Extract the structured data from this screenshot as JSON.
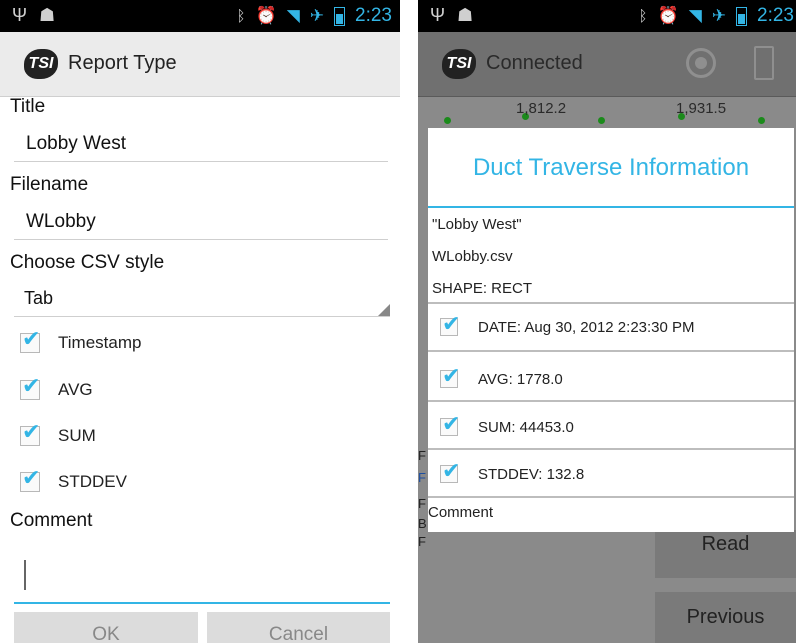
{
  "left": {
    "status": {
      "time": "2:23"
    },
    "actionbar": {
      "logo": "TSI",
      "title": "Report Type"
    },
    "form": {
      "title_label": "Title",
      "title_value": "Lobby West",
      "filename_label": "Filename",
      "filename_value": "WLobby",
      "csv_label": "Choose CSV style",
      "csv_value": "Tab",
      "checkboxes": [
        {
          "label": "Timestamp",
          "checked": true
        },
        {
          "label": "AVG",
          "checked": true
        },
        {
          "label": "SUM",
          "checked": true
        },
        {
          "label": "STDDEV",
          "checked": true
        }
      ],
      "comment_label": "Comment",
      "comment_value": "",
      "ok_label": "OK",
      "cancel_label": "Cancel"
    }
  },
  "right": {
    "status": {
      "time": "2:23"
    },
    "actionbar": {
      "logo": "TSI",
      "title": "Connected"
    },
    "background": {
      "value_1": "1,812.2",
      "value_2": "1,931.5",
      "read_label": "Read",
      "previous_label": "Previous"
    },
    "dialog": {
      "title": "Duct Traverse Information",
      "name": "\"Lobby West\"",
      "file": "WLobby.csv",
      "shape": "SHAPE: RECT",
      "rows": [
        {
          "label": "DATE: Aug 30, 2012 2:23:30 PM",
          "checked": true
        },
        {
          "label": "AVG: 1778.0",
          "checked": true
        },
        {
          "label": "SUM: 44453.0",
          "checked": true
        },
        {
          "label": "STDDEV: 132.8",
          "checked": true
        }
      ],
      "comment_label": "Comment"
    }
  },
  "colors": {
    "accent": "#33b5e5",
    "statusbar": "#000000",
    "dim_overlay": "#8a8a8a"
  }
}
